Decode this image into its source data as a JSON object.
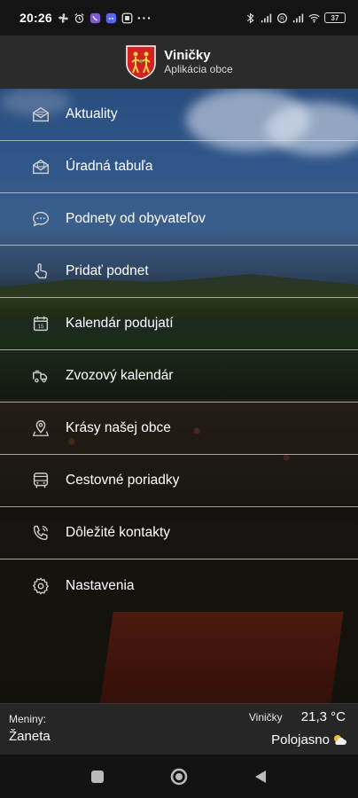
{
  "status_bar": {
    "time": "20:26",
    "more": "···",
    "battery": "37"
  },
  "header": {
    "app_name": "Viničky",
    "subtitle": "Aplikácia obce"
  },
  "menu": {
    "items": [
      {
        "label": "Aktuality",
        "icon": "mail-open-icon"
      },
      {
        "label": "Úradná tabuľa",
        "icon": "mail-stack-icon"
      },
      {
        "label": "Podnety od obyvateľov",
        "icon": "chat-bubble-icon"
      },
      {
        "label": "Pridať podnet",
        "icon": "hand-pointer-icon"
      },
      {
        "label": "Kalendár podujatí",
        "icon": "calendar-icon"
      },
      {
        "label": "Zvozový kalendár",
        "icon": "garbage-truck-icon"
      },
      {
        "label": "Krásy našej obce",
        "icon": "location-pin-icon"
      },
      {
        "label": "Cestovné poriadky",
        "icon": "bus-icon"
      },
      {
        "label": "Dôležité kontakty",
        "icon": "phone-icon"
      },
      {
        "label": "Nastavenia",
        "icon": "gear-icon"
      }
    ]
  },
  "calendar_icon_day": "15",
  "footer": {
    "nameday_label": "Meniny:",
    "nameday_name": "Žaneta",
    "place": "Viničky",
    "temperature": "21,3 °C",
    "weather": "Polojasno",
    "weather_icon": "partly-cloudy-icon"
  },
  "colors": {
    "header_bg": "#2b2b2b",
    "footer_bg": "#262626",
    "divider": "#d2d2d2"
  }
}
